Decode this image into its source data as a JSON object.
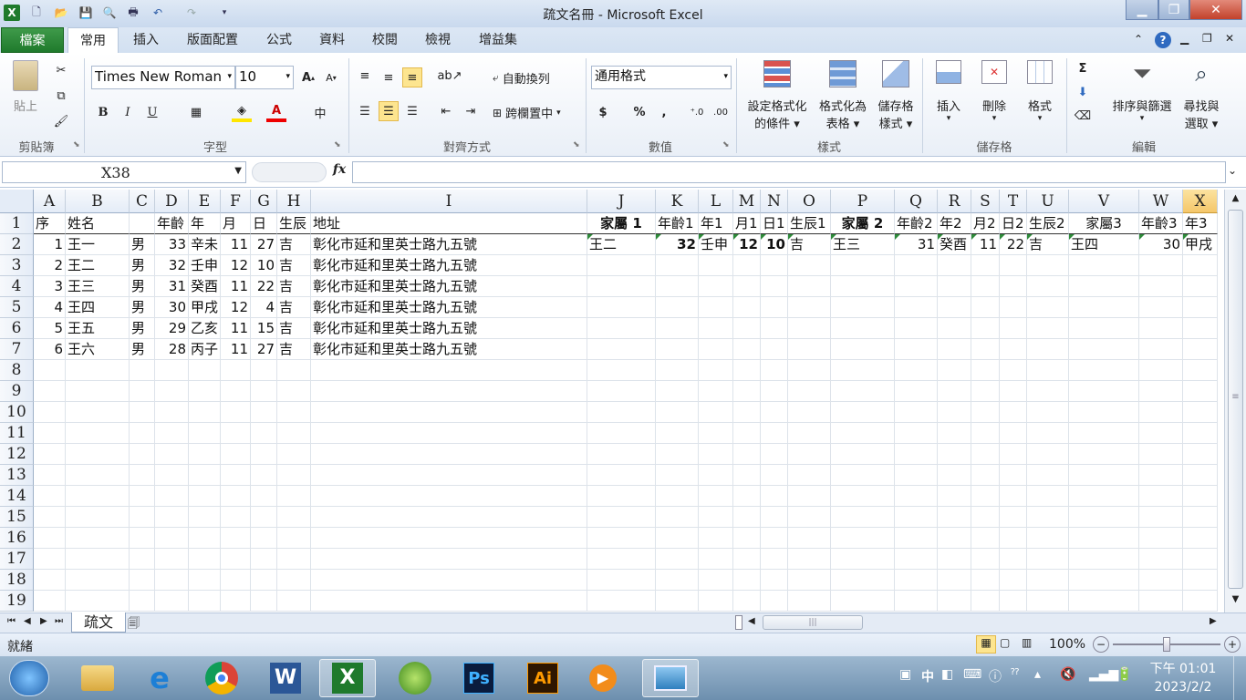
{
  "window": {
    "title": "疏文名冊 - Microsoft Excel"
  },
  "tabs": [
    "檔案",
    "常用",
    "插入",
    "版面配置",
    "公式",
    "資料",
    "校閱",
    "檢視",
    "增益集"
  ],
  "ribbon": {
    "clipboard": {
      "label": "剪貼簿",
      "paste": "貼上"
    },
    "font": {
      "label": "字型",
      "name": "Times New Roman",
      "size": "10",
      "bold": "B",
      "italic": "I",
      "underline": "U"
    },
    "alignment": {
      "label": "對齊方式",
      "wrap": "自動換列",
      "merge": "跨欄置中"
    },
    "number": {
      "label": "數值",
      "format": "通用格式",
      "currency": "$",
      "percent": "%",
      "comma": ","
    },
    "styles": {
      "label": "樣式",
      "conditional": [
        "設定格式化",
        "的條件"
      ],
      "table": [
        "格式化為",
        "表格"
      ],
      "cell": [
        "儲存格",
        "樣式"
      ]
    },
    "cells": {
      "label": "儲存格",
      "insert": "插入",
      "delete": "刪除",
      "format": "格式"
    },
    "editing": {
      "label": "編輯",
      "sigma": "Σ",
      "sort": [
        "排序與篩選"
      ],
      "find": [
        "尋找與",
        "選取"
      ]
    }
  },
  "formula_bar": {
    "name_box": "X38",
    "fx": "fx",
    "formula": ""
  },
  "columns": [
    "A",
    "B",
    "C",
    "D",
    "E",
    "F",
    "G",
    "H",
    "I",
    "J",
    "K",
    "L",
    "M",
    "N",
    "O",
    "P",
    "Q",
    "R",
    "S",
    "T",
    "U",
    "V",
    "W",
    "X"
  ],
  "row_numbers": [
    "1",
    "2",
    "3",
    "4",
    "5",
    "6",
    "7",
    "8",
    "9",
    "10",
    "11",
    "12",
    "13",
    "14",
    "15",
    "16",
    "17",
    "18",
    "19"
  ],
  "rows": [
    [
      "序",
      "姓名",
      "",
      "年齡",
      "年",
      "月",
      "日",
      "生辰",
      "地址",
      "家屬 1",
      "年齡1",
      "年1",
      "月1",
      "日1",
      "生辰1",
      "家屬 2",
      "年齡2",
      "年2",
      "月2",
      "日2",
      "生辰2",
      "家屬3",
      "年齡3",
      "年3"
    ],
    [
      "1",
      "王一",
      "男",
      "33",
      "辛未",
      "11",
      "27",
      "吉",
      "彰化市延和里英士路九五號",
      "王二",
      "32",
      "壬申",
      "12",
      "10",
      "吉",
      "王三",
      "31",
      "癸酉",
      "11",
      "22",
      "吉",
      "王四",
      "30",
      "甲戌"
    ],
    [
      "2",
      "王二",
      "男",
      "32",
      "壬申",
      "12",
      "10",
      "吉",
      "彰化市延和里英士路九五號"
    ],
    [
      "3",
      "王三",
      "男",
      "31",
      "癸酉",
      "11",
      "22",
      "吉",
      "彰化市延和里英士路九五號"
    ],
    [
      "4",
      "王四",
      "男",
      "30",
      "甲戌",
      "12",
      "4",
      "吉",
      "彰化市延和里英士路九五號"
    ],
    [
      "5",
      "王五",
      "男",
      "29",
      "乙亥",
      "11",
      "15",
      "吉",
      "彰化市延和里英士路九五號"
    ],
    [
      "6",
      "王六",
      "男",
      "28",
      "丙子",
      "11",
      "27",
      "吉",
      "彰化市延和里英士路九五號"
    ]
  ],
  "selected_column": "X",
  "sheets": [
    "疏文"
  ],
  "status": {
    "ready": "就緒",
    "zoom": "100%"
  },
  "clock": {
    "time": "下午 01:01",
    "date": "2023/2/2"
  },
  "tray": {
    "ime": "中"
  },
  "colors": {
    "file_tab": "#2a8a36",
    "selection": "#f5c76a",
    "green_triangle": "#2e8b3a"
  }
}
